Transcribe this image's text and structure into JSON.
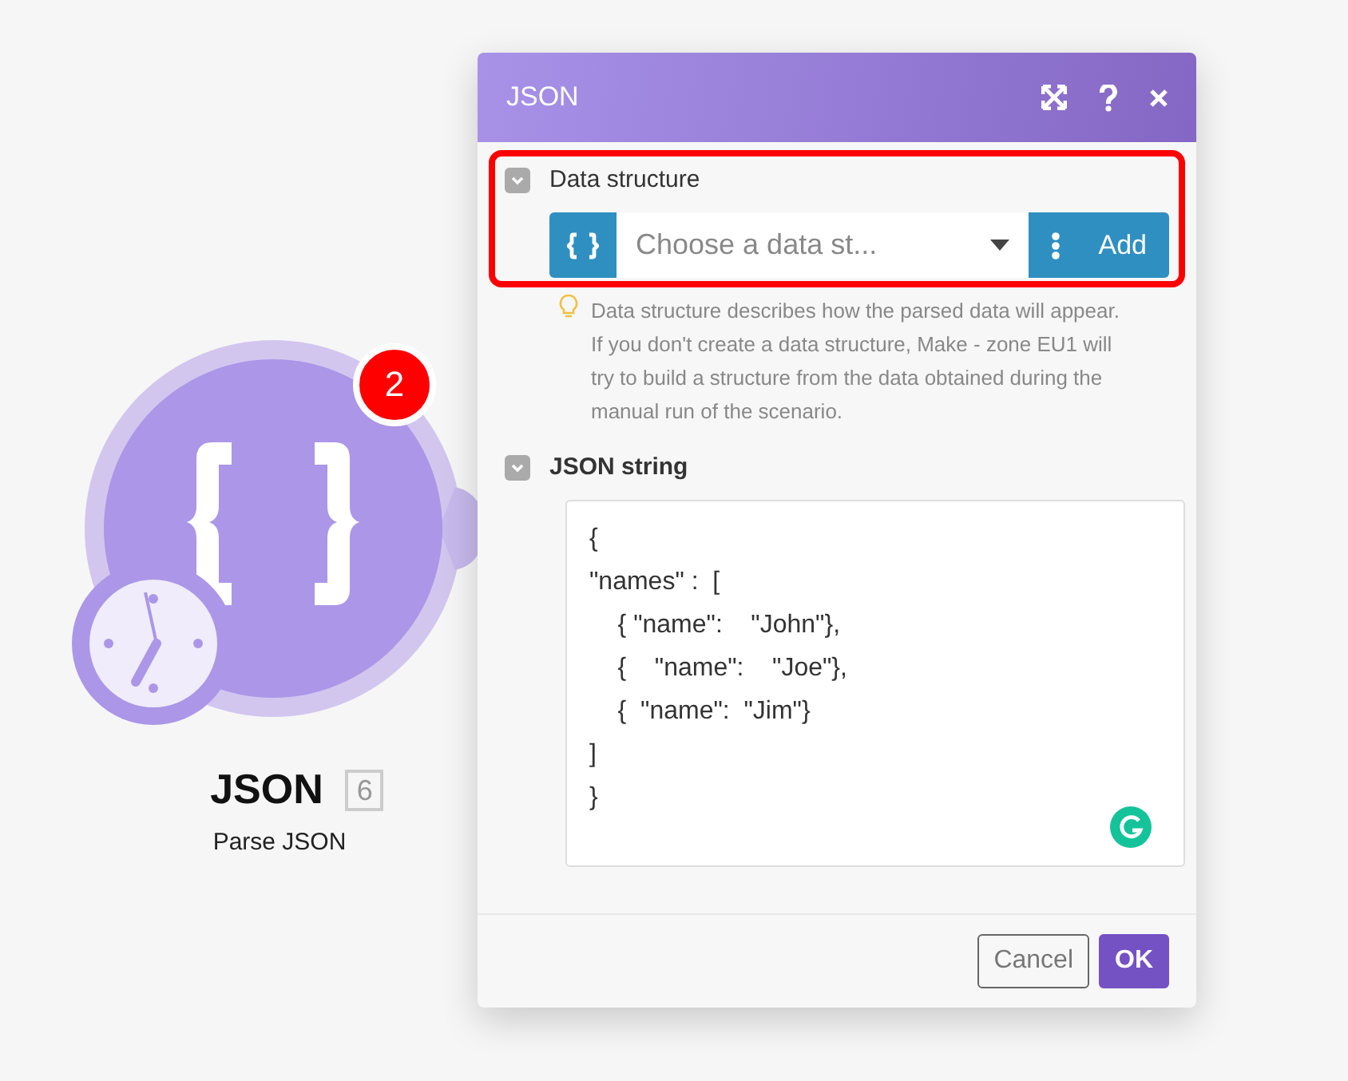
{
  "module": {
    "title": "JSON",
    "id_badge": "6",
    "subtitle": "Parse JSON",
    "notification_count": "2"
  },
  "dialog": {
    "title": "JSON",
    "sections": [
      {
        "kind": "select",
        "label": "Data structure",
        "expanded": true,
        "highlighted": true,
        "placeholder": "Choose a data st...",
        "add_label": "Add",
        "hint": "Data structure describes how the parsed data will appear. If you don't create a data structure, Make - zone EU1 will try to build a structure from the data obtained during the manual run of the scenario."
      },
      {
        "kind": "text",
        "label": "JSON string",
        "expanded": true,
        "highlighted": false,
        "value": "{\n\"names\" :  [\n    { \"name\":    \"John\"},\n    {    \"name\":    \"Joe\"},\n    {  \"name\":  \"Jim\"}\n]\n}"
      }
    ],
    "buttons": [
      {
        "label": "Cancel",
        "kind": "secondary"
      },
      {
        "label": "OK",
        "kind": "primary"
      }
    ]
  }
}
